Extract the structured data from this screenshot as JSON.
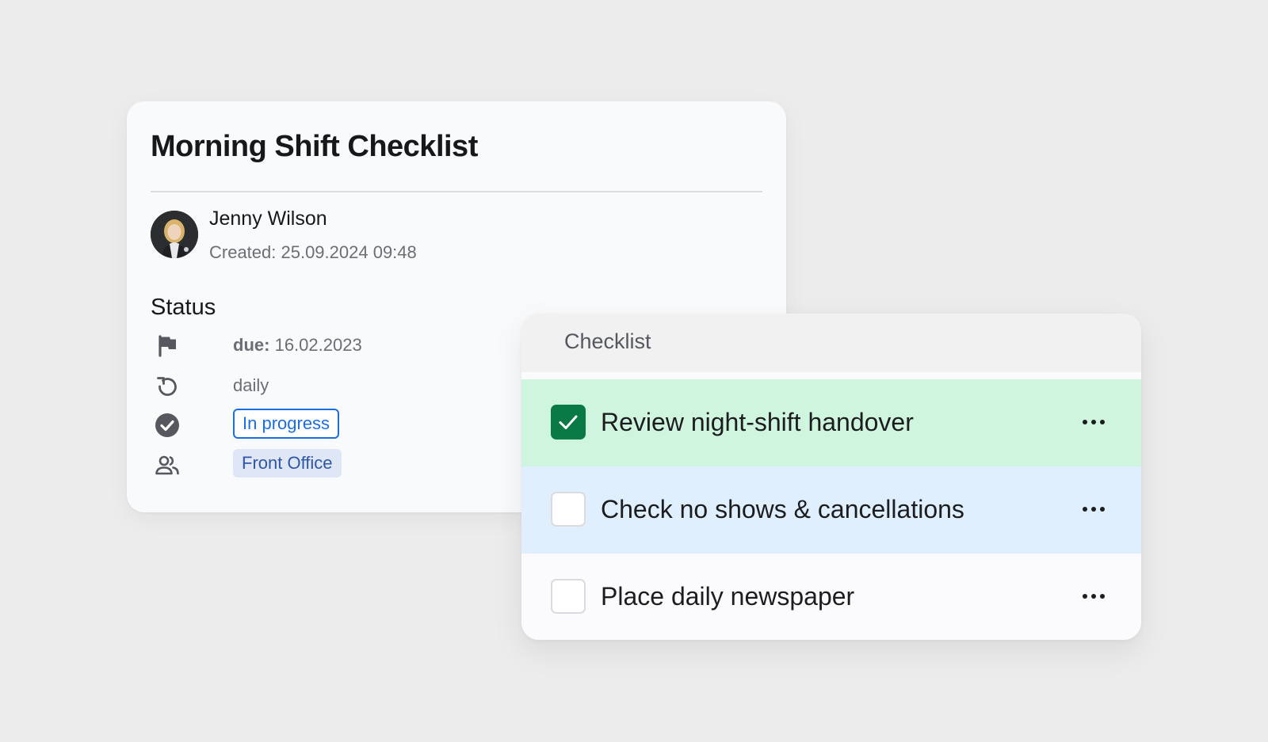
{
  "task": {
    "title": "Morning Shift Checklist",
    "author": {
      "name": "Jenny Wilson",
      "created": "Created: 25.09.2024 09:48"
    },
    "status_heading": "Status",
    "due": {
      "label": "due:",
      "value": "16.02.2023",
      "icon": "flag-icon"
    },
    "recurrence": {
      "value": "daily",
      "icon": "repeat-icon"
    },
    "state": {
      "value": "In progress",
      "icon": "check-circle-icon",
      "color": "#1a6fe0"
    },
    "team": {
      "value": "Front Office",
      "icon": "people-icon",
      "color": "#2f57a8",
      "background": "#dfe6f6"
    }
  },
  "checklist": {
    "title": "Checklist",
    "items": [
      {
        "label": "Review night-shift handover",
        "checked": true,
        "highlight": "#d0f5df"
      },
      {
        "label": "Check no shows & cancellations",
        "checked": false,
        "highlight": "#e0effe"
      },
      {
        "label": "Place daily newspaper",
        "checked": false,
        "highlight": "#fbfbfd"
      }
    ],
    "check_color": "#0a7a45"
  }
}
